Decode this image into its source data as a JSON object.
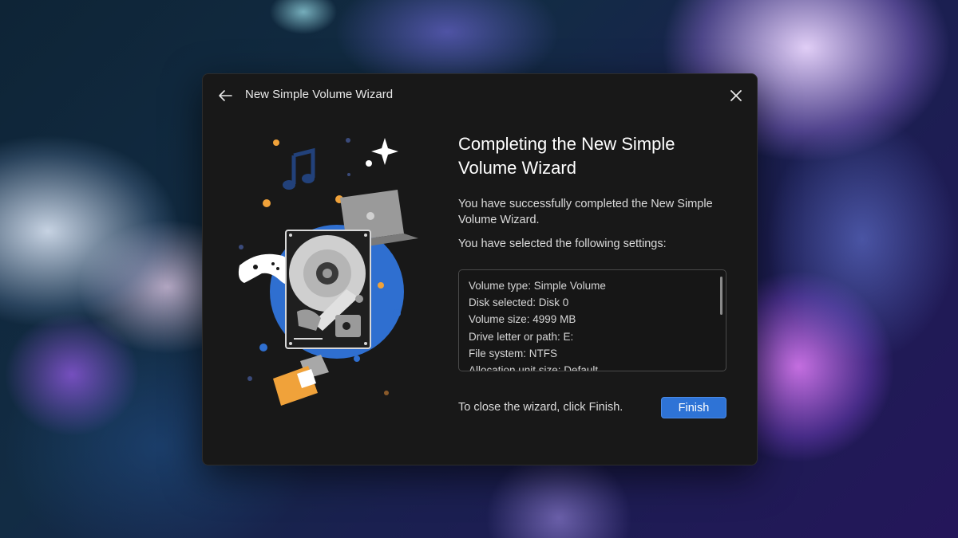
{
  "window": {
    "title": "New Simple Volume Wizard",
    "back_icon": "arrow-left-icon",
    "close_icon": "close-icon"
  },
  "content": {
    "heading": "Completing the New Simple Volume Wizard",
    "success_text": "You have successfully completed the New Simple Volume Wizard.",
    "selected_text": "You have selected the following settings:",
    "settings": [
      "Volume type: Simple Volume",
      "Disk selected: Disk 0",
      "Volume size: 4999 MB",
      "Drive letter or path: E:",
      "File system: NTFS",
      "Allocation unit size: Default"
    ],
    "close_note": "To close the wizard, click Finish.",
    "finish_label": "Finish"
  },
  "colors": {
    "dialog_bg": "#181818",
    "accent": "#2e73d6",
    "illustration_circle": "#2f6fd0",
    "folder": "#f0a23a"
  }
}
